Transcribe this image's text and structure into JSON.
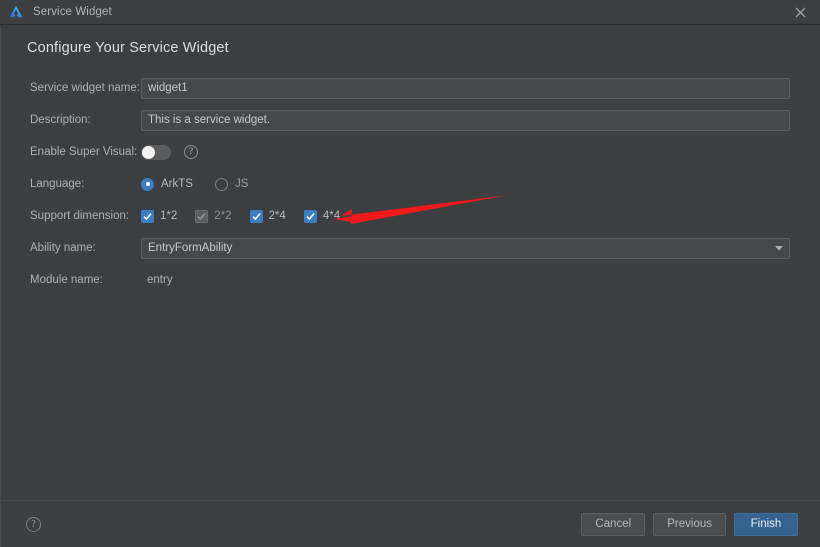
{
  "window": {
    "title": "Service Widget",
    "logo_icon": "deveco-triangle-logo",
    "close_icon": "close-icon"
  },
  "page": {
    "title": "Configure Your Service Widget"
  },
  "form": {
    "widget_name": {
      "label": "Service widget name:",
      "value": "widget1",
      "placeholder": ""
    },
    "description": {
      "label": "Description:",
      "value": "This is a service widget.",
      "placeholder": ""
    },
    "super_visual": {
      "label": "Enable Super Visual:",
      "state": "off",
      "help_icon": "question-circle-icon"
    },
    "language": {
      "label": "Language:",
      "selected": "ArkTS",
      "options": [
        {
          "label": "ArkTS",
          "selected": true
        },
        {
          "label": "JS",
          "selected": false
        }
      ]
    },
    "support_dimension": {
      "label": "Support dimension:",
      "options": [
        {
          "label": "1*2",
          "checked": true,
          "disabled": false
        },
        {
          "label": "2*2",
          "checked": true,
          "disabled": true
        },
        {
          "label": "2*4",
          "checked": true,
          "disabled": false
        },
        {
          "label": "4*4",
          "checked": true,
          "disabled": false
        }
      ]
    },
    "ability_name": {
      "label": "Ability name:",
      "value": "EntryFormAbility",
      "arrow_icon": "chevron-down-icon"
    },
    "module_name": {
      "label": "Module name:",
      "value": "entry"
    }
  },
  "footer": {
    "help_icon": "question-circle-icon",
    "cancel_label": "Cancel",
    "previous_label": "Previous",
    "finish_label": "Finish"
  },
  "annotation": {
    "type": "red-arrow",
    "color": "#f01a1a",
    "points_to": "support-dimension-checkboxes"
  },
  "colors": {
    "window_bg": "#3c3f41",
    "accent_blue": "#3d7ec0",
    "primary_button": "#36628f",
    "input_bg": "#45484a",
    "text": "#b8b8b8"
  }
}
